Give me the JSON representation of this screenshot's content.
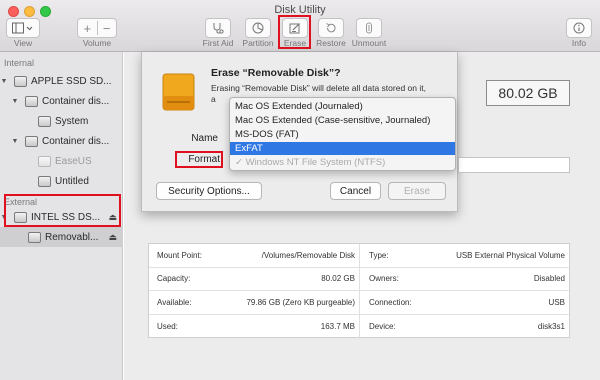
{
  "window": {
    "title": "Disk Utility"
  },
  "toolbar": {
    "view_label": "View",
    "volume_label": "Volume",
    "first_aid_label": "First Aid",
    "partition_label": "Partition",
    "erase_label": "Erase",
    "restore_label": "Restore",
    "unmount_label": "Unmount",
    "info_label": "Info"
  },
  "sidebar": {
    "internal_header": "Internal",
    "external_header": "External",
    "items": [
      {
        "label": "APPLE SSD SD..."
      },
      {
        "label": "Container dis..."
      },
      {
        "label": "System"
      },
      {
        "label": "Container dis..."
      },
      {
        "label": "EaseUS"
      },
      {
        "label": "Untitled"
      },
      {
        "label": "INTEL SS DS..."
      },
      {
        "label": "Removabl..."
      }
    ],
    "eject_glyph": "⏏"
  },
  "main": {
    "capacity_display": "80.02 GB"
  },
  "dialog": {
    "title": "Erase “Removable Disk”?",
    "message": "Erasing “Removable Disk” will delete all data stored on it,",
    "message_line2": "a",
    "name_label": "Name",
    "format_label": "Format",
    "security_button": "Security Options...",
    "cancel_button": "Cancel",
    "erase_button": "Erase"
  },
  "format_menu": {
    "options": [
      {
        "label": "Mac OS Extended (Journaled)",
        "state": "normal"
      },
      {
        "label": "Mac OS Extended (Case-sensitive, Journaled)",
        "state": "normal"
      },
      {
        "label": "MS-DOS (FAT)",
        "state": "normal"
      },
      {
        "label": "ExFAT",
        "state": "selected"
      },
      {
        "label": "✓ Windows NT File System (NTFS)",
        "state": "disabled"
      }
    ]
  },
  "info_table": {
    "rows": [
      {
        "k1": "Mount Point:",
        "v1": "/Volumes/Removable Disk",
        "k2": "Type:",
        "v2": "USB External Physical Volume"
      },
      {
        "k1": "Capacity:",
        "v1": "80.02 GB",
        "k2": "Owners:",
        "v2": "Disabled"
      },
      {
        "k1": "Available:",
        "v1": "79.86 GB (Zero KB purgeable)",
        "k2": "Connection:",
        "v2": "USB"
      },
      {
        "k1": "Used:",
        "v1": "163.7 MB",
        "k2": "Device:",
        "v2": "disk3s1"
      }
    ]
  },
  "colors": {
    "highlight": "#e01020",
    "menu_selection": "#2f78e4"
  }
}
